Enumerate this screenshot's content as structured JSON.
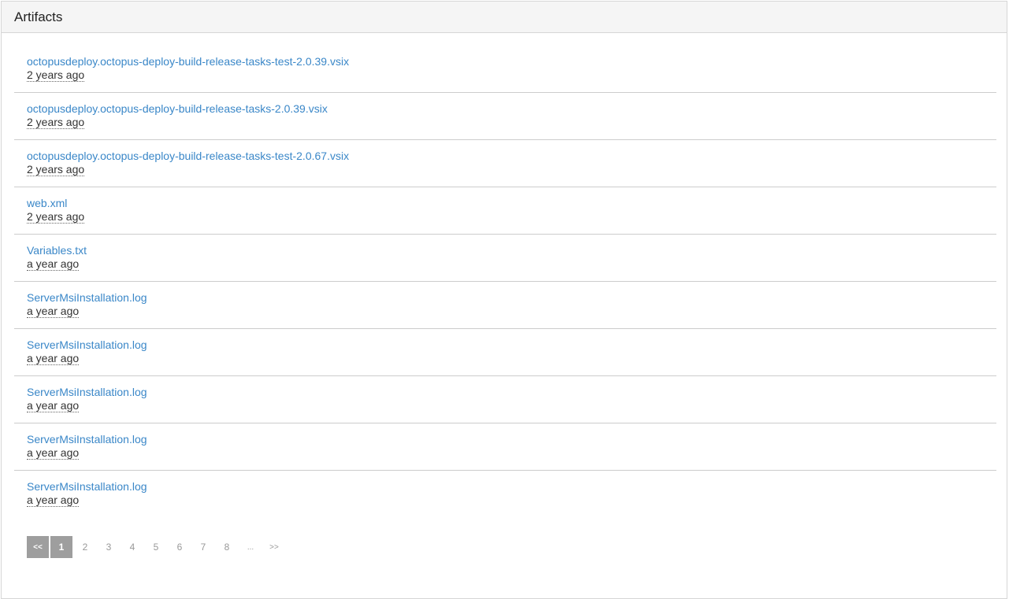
{
  "panel": {
    "title": "Artifacts"
  },
  "artifacts": [
    {
      "name": "octopusdeploy.octopus-deploy-build-release-tasks-test-2.0.39.vsix",
      "time": "2 years ago"
    },
    {
      "name": "octopusdeploy.octopus-deploy-build-release-tasks-2.0.39.vsix",
      "time": "2 years ago"
    },
    {
      "name": "octopusdeploy.octopus-deploy-build-release-tasks-test-2.0.67.vsix",
      "time": "2 years ago"
    },
    {
      "name": "web.xml",
      "time": "2 years ago"
    },
    {
      "name": "Variables.txt",
      "time": "a year ago"
    },
    {
      "name": "ServerMsiInstallation.log",
      "time": "a year ago"
    },
    {
      "name": "ServerMsiInstallation.log",
      "time": "a year ago"
    },
    {
      "name": "ServerMsiInstallation.log",
      "time": "a year ago"
    },
    {
      "name": "ServerMsiInstallation.log",
      "time": "a year ago"
    },
    {
      "name": "ServerMsiInstallation.log",
      "time": "a year ago"
    }
  ],
  "pagination": {
    "first": "<<",
    "pages": [
      "1",
      "2",
      "3",
      "4",
      "5",
      "6",
      "7",
      "8"
    ],
    "current": "1",
    "ellipsis": "...",
    "next": ">>"
  },
  "colors": {
    "link": "#3a87c8",
    "header_bg": "#f5f5f5",
    "active_page_bg": "#9e9e9e"
  }
}
